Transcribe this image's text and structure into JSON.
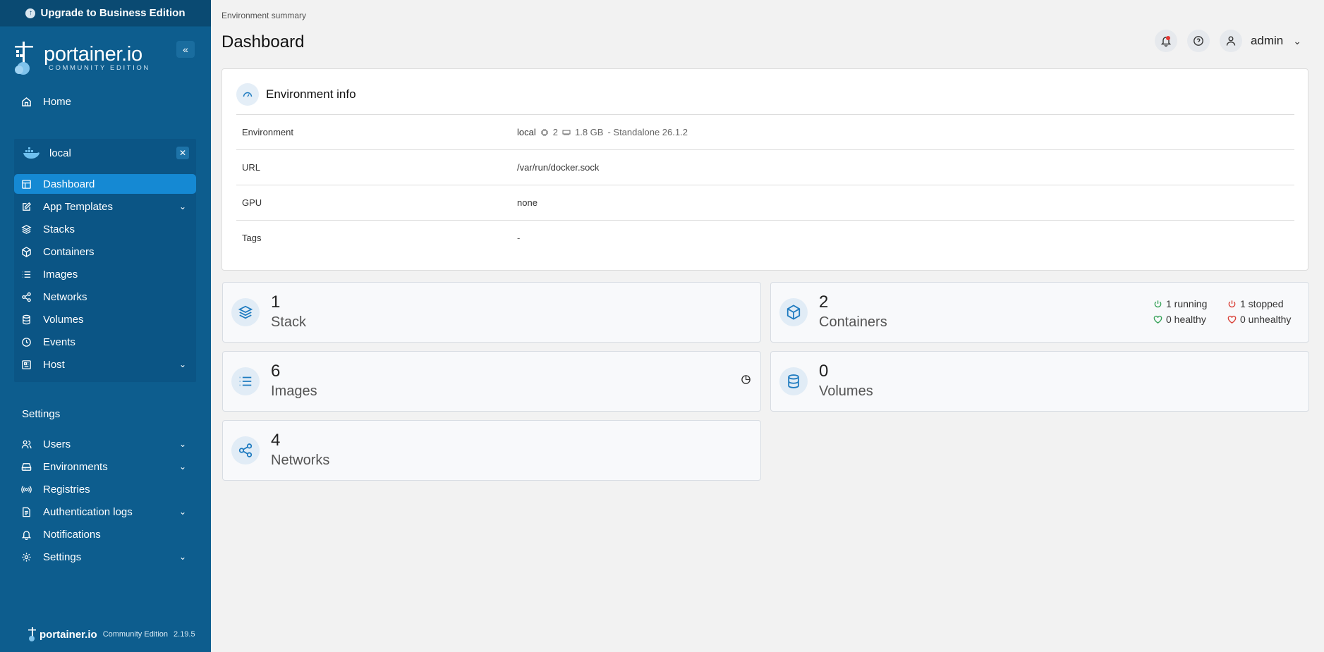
{
  "sidebar": {
    "upgrade_label": "Upgrade to Business Edition",
    "brand_name": "portainer.io",
    "brand_sub": "COMMUNITY EDITION",
    "home_label": "Home",
    "environment": {
      "name": "local",
      "items": {
        "dashboard": "Dashboard",
        "app_templates": "App Templates",
        "stacks": "Stacks",
        "containers": "Containers",
        "images": "Images",
        "networks": "Networks",
        "volumes": "Volumes",
        "events": "Events",
        "host": "Host"
      }
    },
    "settings_section": "Settings",
    "settings_items": {
      "users": "Users",
      "environments": "Environments",
      "registries": "Registries",
      "auth_logs": "Authentication logs",
      "notifications": "Notifications",
      "settings": "Settings"
    },
    "footer": {
      "name": "portainer.io",
      "edition": "Community Edition",
      "version": "2.19.5"
    }
  },
  "header": {
    "breadcrumb": "Environment summary",
    "title": "Dashboard",
    "user": "admin"
  },
  "env_info": {
    "title": "Environment info",
    "rows": {
      "environment": {
        "label": "Environment",
        "name": "local",
        "cpu": "2",
        "memory": "1.8 GB",
        "type": "- Standalone 26.1.2"
      },
      "url": {
        "label": "URL",
        "value": "/var/run/docker.sock"
      },
      "gpu": {
        "label": "GPU",
        "value": "none"
      },
      "tags": {
        "label": "Tags",
        "value": "-"
      }
    }
  },
  "stats": {
    "stack": {
      "count": "1",
      "label": "Stack"
    },
    "containers": {
      "count": "2",
      "label": "Containers",
      "running": "1 running",
      "stopped": "1 stopped",
      "healthy": "0 healthy",
      "unhealthy": "0 unhealthy"
    },
    "images": {
      "count": "6",
      "label": "Images"
    },
    "volumes": {
      "count": "0",
      "label": "Volumes"
    },
    "networks": {
      "count": "4",
      "label": "Networks"
    }
  },
  "colors": {
    "sidebar_bg": "#0d5d8e",
    "active_item": "#1589d3",
    "accent_icon": "#1f7bc0",
    "running": "#3aa35b",
    "stopped": "#d9433a"
  }
}
